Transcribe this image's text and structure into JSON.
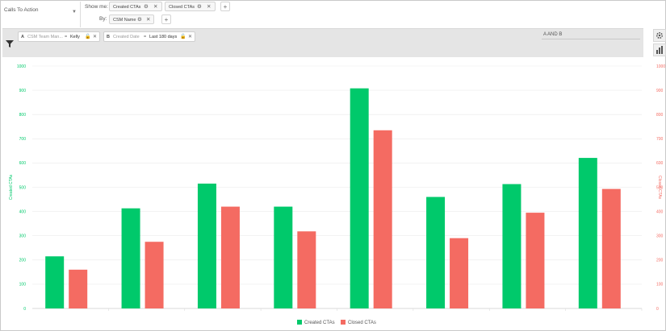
{
  "header": {
    "object_select": "Calls To Action",
    "show_me_label": "Show me:",
    "by_label": "By:",
    "measures": [
      {
        "label": "Created CTAs"
      },
      {
        "label": "Closed CTAs"
      }
    ],
    "group_by": [
      {
        "label": "CSM Name"
      }
    ]
  },
  "filters": {
    "items": [
      {
        "letter": "A",
        "field": "CSM Team Man...",
        "operator": "=",
        "value": "Kelly"
      },
      {
        "letter": "B",
        "field": "Created Date",
        "operator": "=",
        "value": "Last 180 days"
      }
    ],
    "logic": "A AND B"
  },
  "icons": {
    "filter": "funnel-icon",
    "settings": "gear-icon",
    "remove": "close-icon",
    "add": "plus-icon",
    "lock": "lock-icon",
    "chart_type": "bar-chart-icon",
    "dropdown": "chevron-down-icon"
  },
  "colors": {
    "created": "#00c96b",
    "closed": "#f46b62",
    "filter_bar": "#e5e5e5"
  },
  "chart_data": {
    "type": "bar",
    "categories": [
      "",
      "",
      "",
      "",
      "",
      "",
      "",
      ""
    ],
    "series": [
      {
        "name": "Created CTAs",
        "values": [
          215,
          413,
          515,
          420,
          908,
          460,
          513,
          621
        ]
      },
      {
        "name": "Closed CTAs",
        "values": [
          160,
          275,
          420,
          318,
          735,
          290,
          395,
          493
        ]
      }
    ],
    "ylabel": "Created CTAs",
    "y2label": "Closed CTAs",
    "ylim": [
      0,
      1000
    ],
    "y2lim": [
      0,
      1000
    ],
    "yticks": [
      0,
      100,
      200,
      300,
      400,
      500,
      600,
      700,
      800,
      900,
      1000
    ],
    "grid": true,
    "legend": "bottom-center"
  }
}
